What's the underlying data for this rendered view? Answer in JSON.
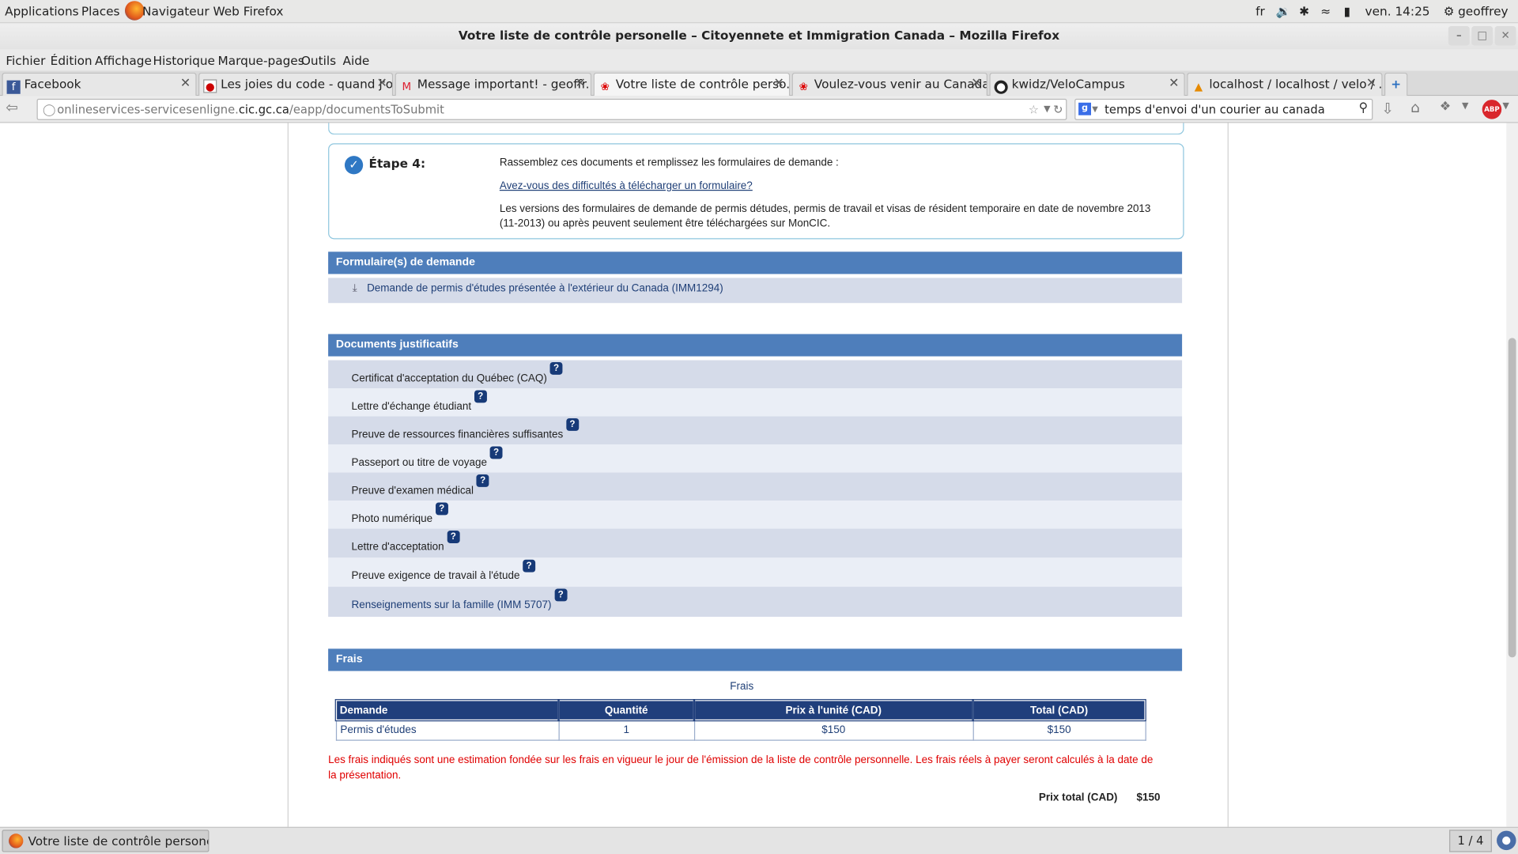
{
  "panel": {
    "applications": "Applications",
    "places": "Places",
    "active_app": "Navigateur Web Firefox",
    "lang": "fr",
    "clock": "ven. 14:25",
    "user": "geoffrey"
  },
  "window": {
    "title": "Votre liste de contrôle personelle – Citoyennete et Immigration Canada – Mozilla Firefox"
  },
  "menu": [
    "Fichier",
    "Édition",
    "Affichage",
    "Historique",
    "Marque-pages",
    "Outils",
    "Aide"
  ],
  "tabs": [
    {
      "label": "Facebook"
    },
    {
      "label": "Les joies du code - quand j'o..."
    },
    {
      "label": "Message important! - geoffr..."
    },
    {
      "label": "Votre liste de contrôle perso..."
    },
    {
      "label": "Voulez-vous venir au Canada..."
    },
    {
      "label": "kwidz/VeloCampus"
    },
    {
      "label": "localhost / localhost / velo / ..."
    }
  ],
  "nav": {
    "url_prefix": "onlineservices-servicesenligne.",
    "url_domain": "cic.gc.ca",
    "url_path": "/eapp/documentsToSubmit",
    "search_value": "temps d'envoi d'un courier au canada",
    "abp": "ABP"
  },
  "step4": {
    "title": "Étape 4:",
    "intro": "Rassemblez ces documents et remplissez les formulaires de demande :",
    "help_link": "Avez-vous des difficultés à télécharger un formulaire?",
    "note_line1": "Les versions des formulaires de demande de permis détudes, permis de travail et visas de résident temporaire en date de novembre 2013",
    "note_line2": "(11-2013)  ou après peuvent seulement être téléchargées sur MonCIC."
  },
  "forms": {
    "heading": "Formulaire(s) de demande",
    "item": "Demande de permis d'études présentée à l'extérieur du Canada (IMM1294)"
  },
  "docs": {
    "heading": "Documents justificatifs",
    "items": [
      "Certificat d'acceptation du Québec (CAQ)",
      "Lettre d'échange étudiant",
      "Preuve de ressources financières suffisantes",
      "Passeport ou titre de voyage",
      "Preuve d'examen médical",
      "Photo numérique",
      "Lettre d'acceptation",
      "Preuve exigence de travail à l'étude",
      "Renseignements sur la famille (IMM 5707)"
    ],
    "help_mark": "?"
  },
  "fees": {
    "heading": "Frais",
    "caption": "Frais",
    "columns": [
      "Demande",
      "Quantité",
      "Prix à l'unité (CAD)",
      "Total (CAD)"
    ],
    "rows": [
      [
        "Permis d'études",
        "1",
        "$150",
        "$150"
      ]
    ],
    "disclaimer": "Les frais indiqués sont une estimation fondée sur les frais en vigueur le jour de l'émission de la liste de contrôle personnelle. Les frais réels à payer seront calculés à la date de la présentation.",
    "total_label": "Prix total (CAD)",
    "total_value": "$150"
  },
  "taskbar": {
    "window_label": "Votre liste de contrôle personelle ...",
    "workspace": "1 / 4"
  },
  "colors": {
    "section_header": "#4e7ebb",
    "table_header": "#203f7c",
    "disclaimer": "#e00000",
    "link": "#1f3f77"
  }
}
